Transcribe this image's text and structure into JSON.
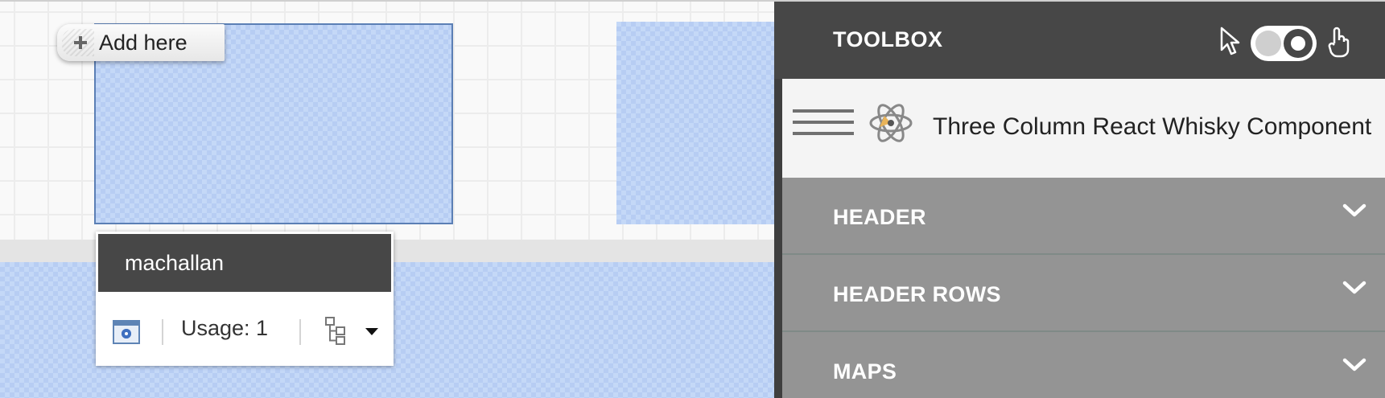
{
  "canvas": {
    "add_here_label": "Add here"
  },
  "component_popup": {
    "title": "machallan",
    "usage_label": "Usage: 1",
    "settings_icon": "settings-window-icon",
    "tree_icon": "component-tree-icon"
  },
  "toolbox": {
    "title": "TOOLBOX",
    "component_name": "Three Column React Whisky Component",
    "sections": [
      {
        "label": "HEADER"
      },
      {
        "label": "HEADER ROWS"
      },
      {
        "label": "MAPS"
      }
    ]
  },
  "colors": {
    "toolbox_header": "#474747",
    "section_bg": "#949494",
    "drop_zone": "#c4d8f7",
    "drop_zone_border": "#5b7fb5"
  }
}
